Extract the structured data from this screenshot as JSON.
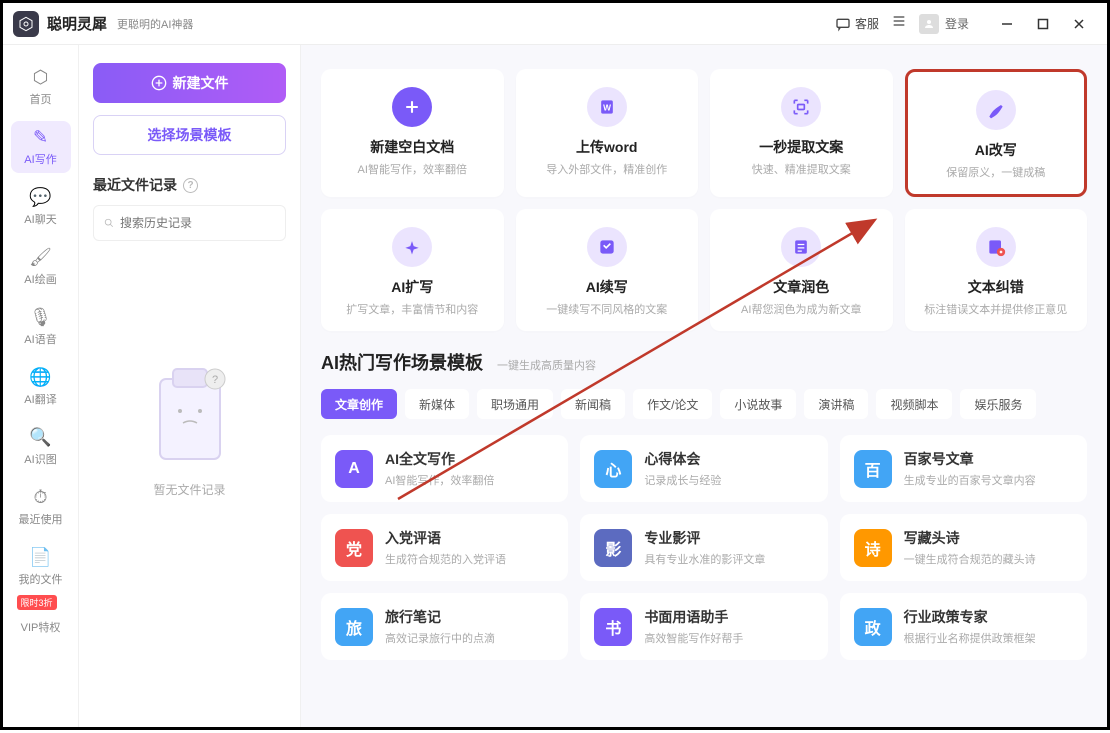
{
  "titlebar": {
    "app_name": "聪明灵犀",
    "tagline": "更聪明的AI神器",
    "support_label": "客服",
    "login_label": "登录"
  },
  "sidebar": {
    "items": [
      {
        "label": "首页"
      },
      {
        "label": "AI写作"
      },
      {
        "label": "AI聊天"
      },
      {
        "label": "AI绘画"
      },
      {
        "label": "AI语音"
      },
      {
        "label": "AI翻译"
      },
      {
        "label": "AI识图"
      },
      {
        "label": "最近使用"
      },
      {
        "label": "我的文件"
      },
      {
        "label": "VIP特权"
      }
    ],
    "vip_badge": "限时3折"
  },
  "filespanel": {
    "new_file_label": "新建文件",
    "choose_template_label": "选择场景模板",
    "recent_header": "最近文件记录",
    "search_placeholder": "搜索历史记录",
    "empty_text": "暂无文件记录"
  },
  "feature_cards": [
    {
      "title": "新建空白文档",
      "desc": "AI智能写作，效率翻倍",
      "icon": "plus"
    },
    {
      "title": "上传word",
      "desc": "导入外部文件，精准创作",
      "icon": "word"
    },
    {
      "title": "一秒提取文案",
      "desc": "快速、精准提取文案",
      "icon": "extract"
    },
    {
      "title": "AI改写",
      "desc": "保留原义，一键成稿",
      "icon": "rewrite",
      "highlight": true
    },
    {
      "title": "AI扩写",
      "desc": "扩写文章，丰富情节和内容",
      "icon": "expand"
    },
    {
      "title": "AI续写",
      "desc": "一键续写不同风格的文案",
      "icon": "continue"
    },
    {
      "title": "文章润色",
      "desc": "AI帮您润色为成为新文章",
      "icon": "polish"
    },
    {
      "title": "文本纠错",
      "desc": "标注错误文本并提供修正意见",
      "icon": "correct"
    }
  ],
  "template_section": {
    "title": "AI热门写作场景模板",
    "subtitle": "一键生成高质量内容",
    "tabs": [
      "文章创作",
      "新媒体",
      "职场通用",
      "新闻稿",
      "作文/论文",
      "小说故事",
      "演讲稿",
      "视频脚本",
      "娱乐服务"
    ],
    "active_tab": 0,
    "templates": [
      {
        "title": "AI全文写作",
        "desc": "AI智能写作，效率翻倍",
        "color": "purple",
        "glyph": "A"
      },
      {
        "title": "心得体会",
        "desc": "记录成长与经验",
        "color": "blue",
        "glyph": "心"
      },
      {
        "title": "百家号文章",
        "desc": "生成专业的百家号文章内容",
        "color": "blue",
        "glyph": "百"
      },
      {
        "title": "入党评语",
        "desc": "生成符合规范的入党评语",
        "color": "red",
        "glyph": "党"
      },
      {
        "title": "专业影评",
        "desc": "具有专业水准的影评文章",
        "color": "indigo",
        "glyph": "影"
      },
      {
        "title": "写藏头诗",
        "desc": "一键生成符合规范的藏头诗",
        "color": "orange",
        "glyph": "诗"
      },
      {
        "title": "旅行笔记",
        "desc": "高效记录旅行中的点滴",
        "color": "blue",
        "glyph": "旅"
      },
      {
        "title": "书面用语助手",
        "desc": "高效智能写作好帮手",
        "color": "purple",
        "glyph": "书"
      },
      {
        "title": "行业政策专家",
        "desc": "根据行业名称提供政策框架",
        "color": "blue",
        "glyph": "政"
      }
    ]
  }
}
